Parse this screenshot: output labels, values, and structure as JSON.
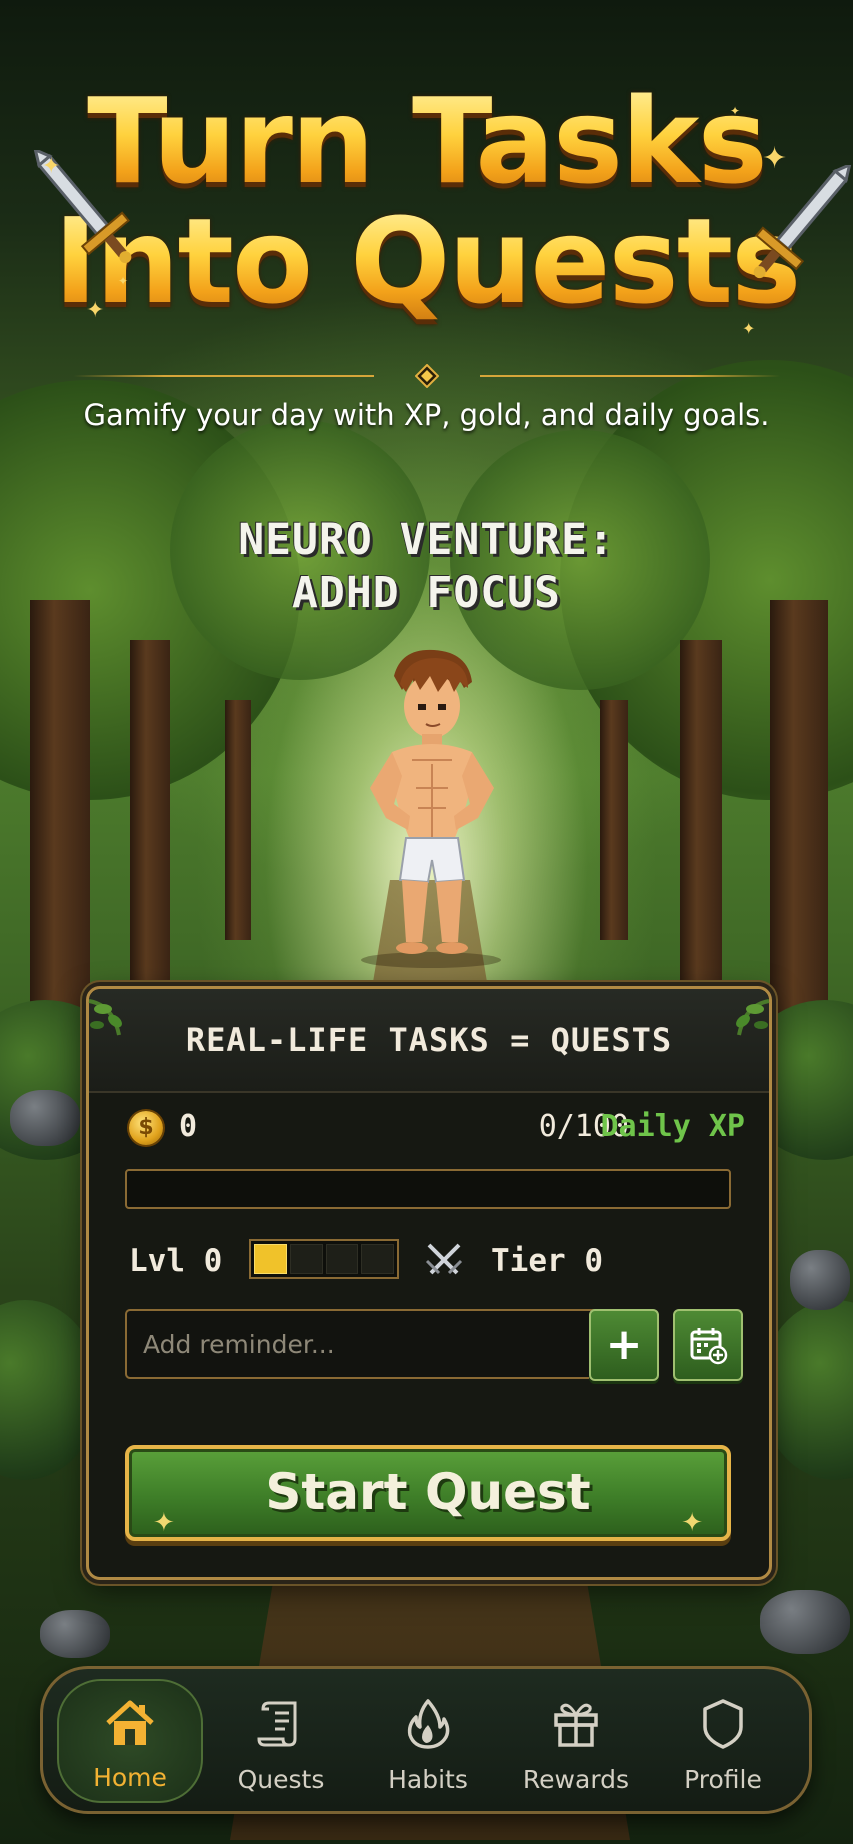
{
  "header": {
    "title_line1": "Turn Tasks",
    "title_line2": "Into Quests",
    "subtitle": "Gamify your day with XP, gold, and daily goals.",
    "game_name_line1": "NEURO VENTURE:",
    "game_name_line2": "ADHD FOCUS"
  },
  "panel": {
    "title": "REAL-LIFE TASKS = QUESTS",
    "coin_symbol": "$",
    "gold": "0",
    "xp_value": "0/100",
    "xp_label": "Daily XP",
    "xp_progress": 0,
    "level_text": "Lvl 0",
    "level_segments_total": 4,
    "level_segments_filled": 1,
    "tier_text": "Tier 0",
    "reminder_placeholder": "Add reminder...",
    "add_symbol": "+",
    "start_label": "Start Quest"
  },
  "nav": {
    "active": "Home",
    "items": [
      {
        "label": "Home",
        "icon": "home-icon"
      },
      {
        "label": "Quests",
        "icon": "scroll-icon"
      },
      {
        "label": "Habits",
        "icon": "flame-icon"
      },
      {
        "label": "Rewards",
        "icon": "gift-icon"
      },
      {
        "label": "Profile",
        "icon": "shield-icon"
      }
    ]
  },
  "colors": {
    "title_gold": "#ffd23e",
    "xp_green": "#6fc44a",
    "frame_gold": "#b08a44",
    "nav_active": "#f3b233",
    "button_green": "#3e7e28"
  }
}
